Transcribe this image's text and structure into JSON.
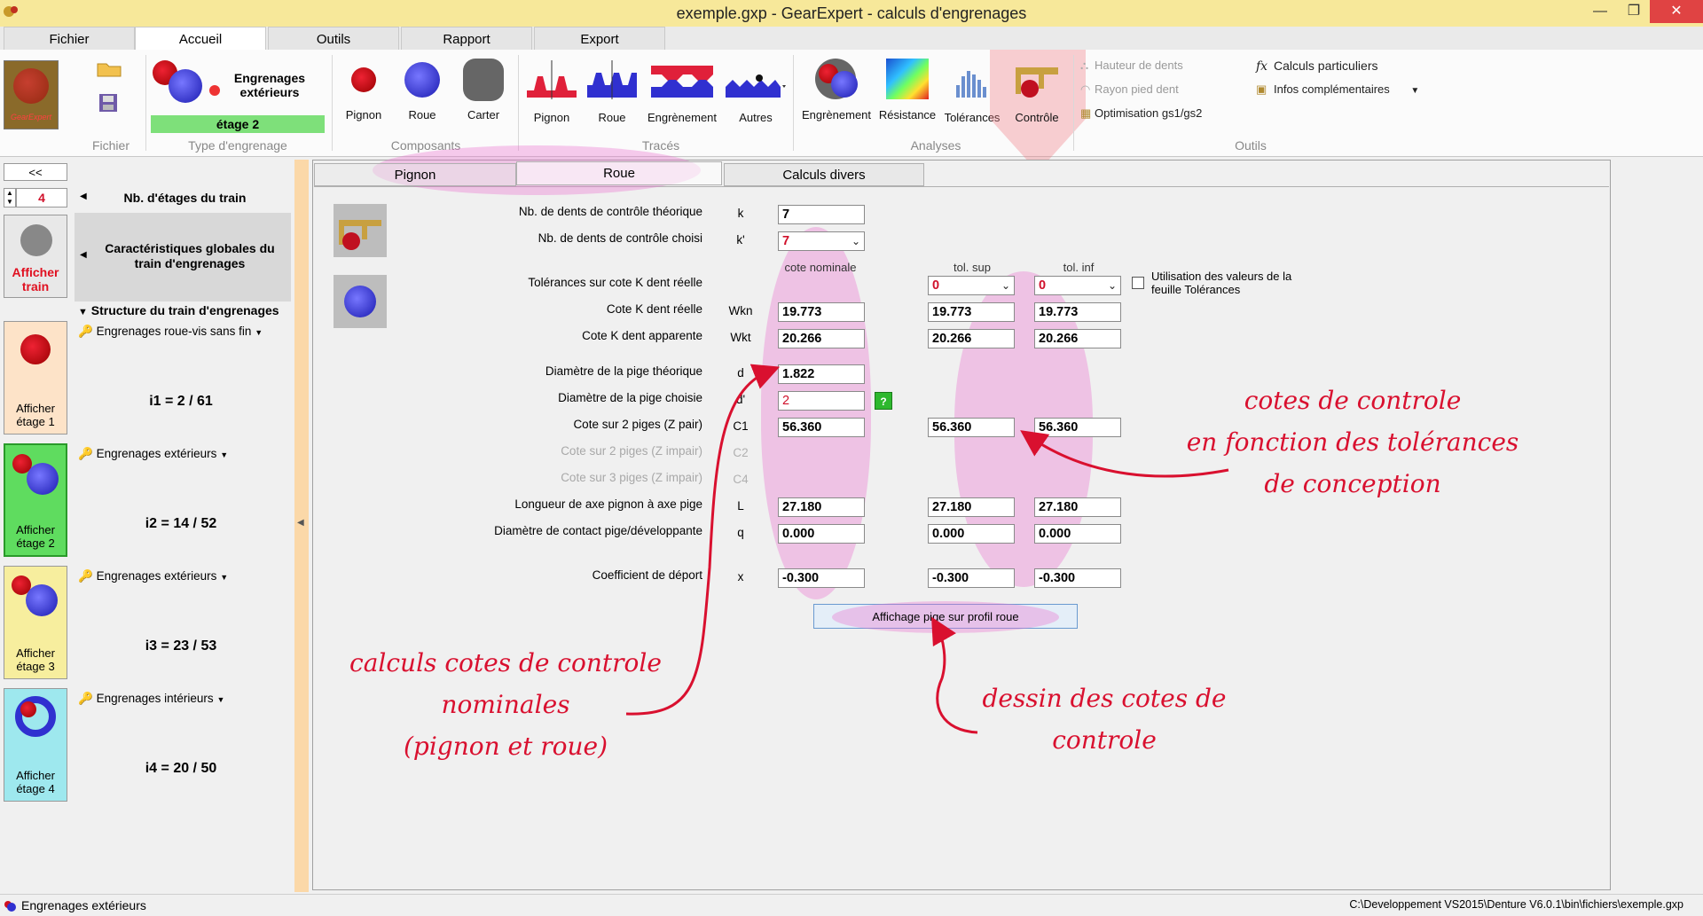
{
  "window": {
    "title": "exemple.gxp - GearExpert - calculs d'engrenages",
    "close": "✕",
    "minimize": "—",
    "maximize": "❐"
  },
  "ribbon_tabs": [
    "Fichier",
    "Accueil",
    "Outils",
    "Rapport",
    "Export"
  ],
  "ribbon": {
    "logo_text": "GearExpert",
    "engrenage_type": "Engrenages extérieurs",
    "engrenage_type_l1": "Engrenages",
    "engrenage_type_l2": "extérieurs",
    "stage": "étage 2",
    "composants": [
      "Pignon",
      "Roue",
      "Carter"
    ],
    "traces": [
      "Pignon",
      "Roue",
      "Engrènement",
      "Autres"
    ],
    "analyses": [
      "Engrènement",
      "Résistance",
      "Tolérances",
      "Contrôle"
    ],
    "outils_left": [
      "Hauteur de dents",
      "Rayon pied dent",
      "Optimisation gs1/gs2"
    ],
    "outils_right": [
      "Calculs particuliers",
      "Infos complémentaires"
    ],
    "groups": [
      "Fichier",
      "Type d'engrenage",
      "Composants",
      "Tracés",
      "Analyses",
      "Outils"
    ]
  },
  "left_panel": {
    "collapse_label": "<<",
    "nb_etages_value": "4",
    "nb_etages_label": "Nb. d'étages du train",
    "afficher_train_l1": "Afficher",
    "afficher_train_l2": "train",
    "caracteristiques_l1": "Caractéristiques globales du",
    "caracteristiques_l2": "train d'engrenages",
    "structure_label": "Structure du train d'engrenages",
    "stages": [
      {
        "type": "Engrenages roue-vis sans fin",
        "ratio": "i1 = 2 / 61",
        "btn_l1": "Afficher",
        "btn_l2": "étage 1",
        "color": "#fde3c8"
      },
      {
        "type": "Engrenages extérieurs",
        "ratio": "i2 = 14 / 52",
        "btn_l1": "Afficher",
        "btn_l2": "étage 2",
        "color": "#5fdc5f"
      },
      {
        "type": "Engrenages extérieurs",
        "ratio": "i3 = 23 / 53",
        "btn_l1": "Afficher",
        "btn_l2": "étage 3",
        "color": "#f7ee9e"
      },
      {
        "type": "Engrenages intérieurs",
        "ratio": "i4 = 20 / 50",
        "btn_l1": "Afficher",
        "btn_l2": "étage 4",
        "color": "#9ee8ee"
      }
    ]
  },
  "main_tabs": [
    "Pignon",
    "Roue",
    "Calculs divers"
  ],
  "form": {
    "col_nominal": "cote nominale",
    "col_tol_sup": "tol. sup",
    "col_tol_inf": "tol. inf",
    "use_tolerances_l1": "Utilisation des valeurs de la",
    "use_tolerances_l2": "feuille Tolérances",
    "rows": [
      {
        "label": "Nb. de dents de contrôle théorique",
        "sym": "k",
        "nominal": "7"
      },
      {
        "label": "Nb. de dents de contrôle choisi",
        "sym": "k'",
        "nominal": "7"
      },
      {
        "label": "Tolérances sur cote K dent réelle",
        "sym": "",
        "sup": "0",
        "inf": "0"
      },
      {
        "label": "Cote K dent réelle",
        "sym": "Wkn",
        "nominal": "19.773",
        "sup": "19.773",
        "inf": "19.773"
      },
      {
        "label": "Cote K dent apparente",
        "sym": "Wkt",
        "nominal": "20.266",
        "sup": "20.266",
        "inf": "20.266"
      },
      {
        "label": "Diamètre de la pige théorique",
        "sym": "d",
        "nominal": "1.822"
      },
      {
        "label": "Diamètre de la pige choisie",
        "sym": "d'",
        "nominal": "2",
        "help": "?"
      },
      {
        "label": "Cote sur 2 piges (Z pair)",
        "sym": "C1",
        "nominal": "56.360",
        "sup": "56.360",
        "inf": "56.360"
      },
      {
        "label": "Cote sur 2 piges (Z impair)",
        "sym": "C2"
      },
      {
        "label": "Cote sur 3 piges (Z impair)",
        "sym": "C4"
      },
      {
        "label": "Longueur de axe pignon à axe pige",
        "sym": "L",
        "nominal": "27.180",
        "sup": "27.180",
        "inf": "27.180"
      },
      {
        "label": "Diamètre de contact pige/développante",
        "sym": "q",
        "nominal": "0.000",
        "sup": "0.000",
        "inf": "0.000"
      },
      {
        "label": "Coefficient de déport",
        "sym": "x",
        "nominal": "-0.300",
        "sup": "-0.300",
        "inf": "-0.300"
      }
    ],
    "button_label": "Affichage pige sur profil roue"
  },
  "annotations": {
    "right_l1": "cotes de controle",
    "right_l2": "en fonction des tolérances",
    "right_l3": "de conception",
    "left_l1": "calculs cotes de controle",
    "left_l2": "nominales",
    "left_l3": "(pignon et roue)",
    "bottom_l1": "dessin des cotes de",
    "bottom_l2": "controle"
  },
  "status": {
    "left": "Engrenages extérieurs",
    "right": "C:\\Developpement VS2015\\Denture V6.0.1\\bin\\fichiers\\exemple.gxp"
  },
  "colors": {
    "accent_pink": "#ec6ecd",
    "annotation_red": "#d9102f",
    "ribbon_bg": "#fbfbfb",
    "title_bg": "#f7e89a"
  }
}
